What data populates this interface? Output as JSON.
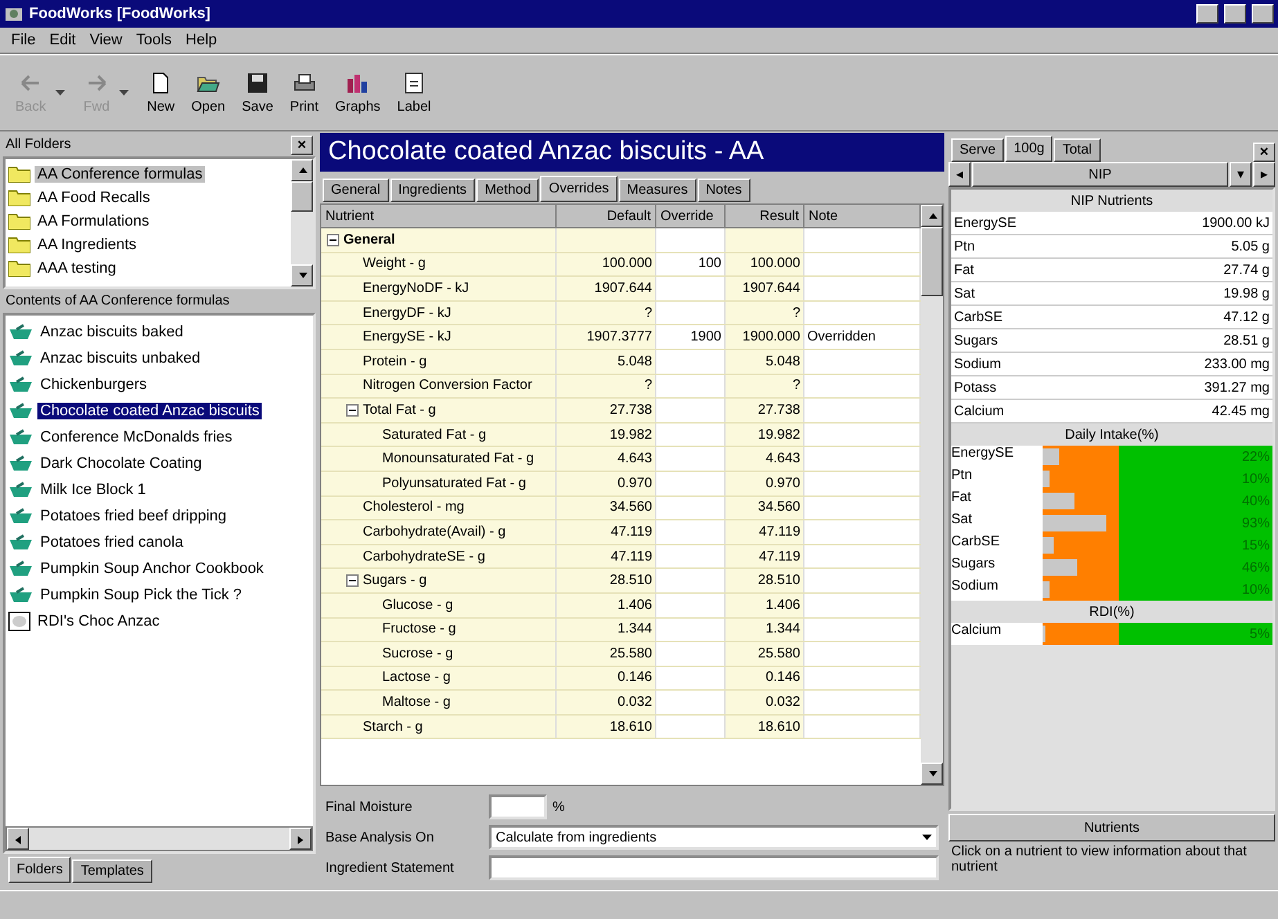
{
  "window": {
    "title": "FoodWorks [FoodWorks]"
  },
  "menu": [
    "File",
    "Edit",
    "View",
    "Tools",
    "Help"
  ],
  "toolbar": [
    {
      "label": "Back",
      "kind": "back",
      "disabled": true,
      "dropdown": true
    },
    {
      "label": "Fwd",
      "kind": "forward",
      "disabled": true,
      "dropdown": true
    },
    {
      "label": "New",
      "kind": "new",
      "disabled": false,
      "dropdown": false
    },
    {
      "label": "Open",
      "kind": "open",
      "disabled": false,
      "dropdown": false
    },
    {
      "label": "Save",
      "kind": "save",
      "disabled": false,
      "dropdown": false
    },
    {
      "label": "Print",
      "kind": "print",
      "disabled": false,
      "dropdown": false
    },
    {
      "label": "Graphs",
      "kind": "graphs",
      "disabled": false,
      "dropdown": false
    },
    {
      "label": "Label",
      "kind": "label",
      "disabled": false,
      "dropdown": false
    }
  ],
  "folders_panel": {
    "title": "All Folders",
    "close": "×",
    "folders": [
      {
        "name": "AA Conference formulas",
        "selected": true
      },
      {
        "name": "AA Food Recalls",
        "selected": false
      },
      {
        "name": "AA Formulations",
        "selected": false
      },
      {
        "name": "AA Ingredients",
        "selected": false
      },
      {
        "name": "AAA testing",
        "selected": false
      }
    ],
    "contents_title": "Contents of AA Conference formulas",
    "contents": [
      {
        "name": "Anzac biscuits baked",
        "kind": "recipe",
        "selected": false
      },
      {
        "name": "Anzac biscuits unbaked",
        "kind": "recipe",
        "selected": false
      },
      {
        "name": "Chickenburgers",
        "kind": "recipe",
        "selected": false
      },
      {
        "name": "Chocolate coated Anzac biscuits",
        "kind": "recipe",
        "selected": true
      },
      {
        "name": "Conference McDonalds fries",
        "kind": "recipe",
        "selected": false
      },
      {
        "name": "Dark Chocolate Coating",
        "kind": "recipe",
        "selected": false
      },
      {
        "name": "Milk Ice Block 1",
        "kind": "recipe",
        "selected": false
      },
      {
        "name": "Potatoes fried beef dripping",
        "kind": "recipe",
        "selected": false
      },
      {
        "name": "Potatoes fried canola",
        "kind": "recipe",
        "selected": false
      },
      {
        "name": "Pumpkin Soup Anchor Cookbook",
        "kind": "recipe",
        "selected": false
      },
      {
        "name": "Pumpkin Soup Pick the Tick ?",
        "kind": "recipe",
        "selected": false
      },
      {
        "name": "RDI's Choc Anzac",
        "kind": "report",
        "selected": false
      }
    ],
    "tabs": [
      {
        "label": "Folders",
        "selected": true
      },
      {
        "label": "Templates",
        "selected": false
      }
    ]
  },
  "document": {
    "title": "Chocolate coated Anzac biscuits - AA",
    "tabs": [
      {
        "label": "General",
        "selected": false
      },
      {
        "label": "Ingredients",
        "selected": false
      },
      {
        "label": "Method",
        "selected": false
      },
      {
        "label": "Overrides",
        "selected": true
      },
      {
        "label": "Measures",
        "selected": false
      },
      {
        "label": "Notes",
        "selected": false
      }
    ],
    "columns": [
      "Nutrient",
      "Default",
      "Override",
      "Result",
      "Note"
    ],
    "rows": [
      {
        "name": "General",
        "expanded": true,
        "children": [
          {
            "name": "Weight - g",
            "default": "100.000",
            "override": "100",
            "result": "100.000"
          },
          {
            "name": "EnergyNoDF - kJ",
            "default": "1907.644",
            "result": "1907.644"
          },
          {
            "name": "EnergyDF - kJ",
            "default": "?",
            "result": "?"
          },
          {
            "name": "EnergySE - kJ",
            "default": "1907.3777",
            "override": "1900",
            "result": "1900.000",
            "note": "Overridden"
          },
          {
            "name": "Protein - g",
            "default": "5.048",
            "result": "5.048"
          },
          {
            "name": "Nitrogen Conversion Factor",
            "default": "?",
            "result": "?"
          },
          {
            "name": "Total Fat - g",
            "default": "27.738",
            "result": "27.738",
            "expanded": true,
            "children": [
              {
                "name": "Saturated Fat - g",
                "default": "19.982",
                "result": "19.982"
              },
              {
                "name": "Monounsaturated Fat - g",
                "default": "4.643",
                "result": "4.643"
              },
              {
                "name": "Polyunsaturated Fat - g",
                "default": "0.970",
                "result": "0.970"
              }
            ]
          },
          {
            "name": "Cholesterol - mg",
            "default": "34.560",
            "result": "34.560"
          },
          {
            "name": "Carbohydrate(Avail) - g",
            "default": "47.119",
            "result": "47.119"
          },
          {
            "name": "CarbohydrateSE - g",
            "default": "47.119",
            "result": "47.119"
          },
          {
            "name": "Sugars - g",
            "default": "28.510",
            "result": "28.510",
            "expanded": true,
            "children": [
              {
                "name": "Glucose - g",
                "default": "1.406",
                "result": "1.406"
              },
              {
                "name": "Fructose - g",
                "default": "1.344",
                "result": "1.344"
              },
              {
                "name": "Sucrose - g",
                "default": "25.580",
                "result": "25.580"
              },
              {
                "name": "Lactose - g",
                "default": "0.146",
                "result": "0.146"
              },
              {
                "name": "Maltose - g",
                "default": "0.032",
                "result": "0.032"
              }
            ]
          },
          {
            "name": "Starch - g",
            "default": "18.610",
            "result": "18.610"
          }
        ]
      }
    ],
    "form": {
      "final_moisture_label": "Final Moisture",
      "final_moisture_unit": "%",
      "base_label": "Base Analysis On",
      "base_value": "Calculate from ingredients",
      "statement_label": "Ingredient Statement"
    }
  },
  "nip_panel": {
    "tabs": [
      {
        "label": "Serve",
        "selected": false
      },
      {
        "label": "100g",
        "selected": true
      },
      {
        "label": "Total",
        "selected": false
      }
    ],
    "close": "×",
    "view": "NIP",
    "prev": "◂",
    "next": "▸",
    "dropdown": "▾",
    "nutrients_title": "NIP Nutrients",
    "nutrients": [
      {
        "name": "EnergySE",
        "value": "1900.00 kJ"
      },
      {
        "name": "Ptn",
        "value": "5.05 g"
      },
      {
        "name": "Fat",
        "value": "27.74 g"
      },
      {
        "name": "Sat",
        "value": "19.98 g"
      },
      {
        "name": "CarbSE",
        "value": "47.12 g"
      },
      {
        "name": "Sugars",
        "value": "28.51 g"
      },
      {
        "name": "Sodium",
        "value": "233.00 mg"
      },
      {
        "name": "Potass",
        "value": "391.27 mg"
      },
      {
        "name": "Calcium",
        "value": "42.45 mg"
      }
    ],
    "intake_title": "Daily Intake(%)",
    "intake": [
      {
        "name": "EnergySE",
        "level": 0.07,
        "reading": "22%"
      },
      {
        "name": "Ptn",
        "level": 0.03,
        "reading": "10%"
      },
      {
        "name": "Fat",
        "level": 0.14,
        "reading": "40%"
      },
      {
        "name": "Sat",
        "level": 0.28,
        "reading": "93%"
      },
      {
        "name": "CarbSE",
        "level": 0.05,
        "reading": "15%"
      },
      {
        "name": "Sugars",
        "level": 0.15,
        "reading": "46%"
      },
      {
        "name": "Sodium",
        "level": 0.03,
        "reading": "10%"
      }
    ],
    "rdi_title": "RDI(%)",
    "rdi": [
      {
        "name": "Calcium",
        "level": 0.01,
        "reading": "5%"
      }
    ],
    "button": "Nutrients",
    "help": "Click on a nutrient to view information about that nutrient"
  }
}
